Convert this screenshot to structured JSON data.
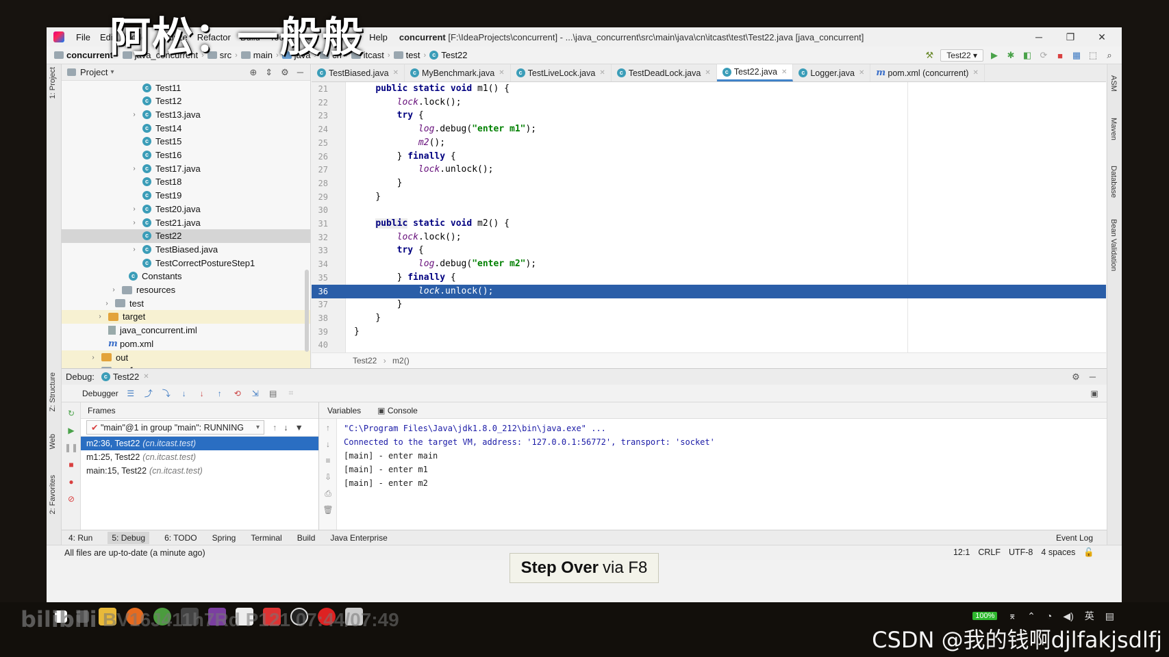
{
  "overlay": {
    "title": "阿松：一般般"
  },
  "menu": {
    "items": [
      "File",
      "Edit",
      "Code",
      "Analyze",
      "Refactor",
      "Build",
      "Tools",
      "VCS",
      "Window",
      "Help"
    ],
    "window_title_bold": "concurrent",
    "window_title_rest": "[F:\\IdeaProjects\\concurrent] - ...\\java_concurrent\\src\\main\\java\\cn\\itcast\\test\\Test22.java [java_concurrent]"
  },
  "navbar": {
    "crumbs": [
      "concurrent",
      "java_concurrent",
      "src",
      "main",
      "java",
      "cn",
      "itcast",
      "test",
      "Test22"
    ],
    "run_config": "Test22"
  },
  "project": {
    "title": "Project",
    "tree": [
      {
        "label": "Test11",
        "kind": "class",
        "indent": 2,
        "chev": false
      },
      {
        "label": "Test12",
        "kind": "class",
        "indent": 2,
        "chev": false
      },
      {
        "label": "Test13.java",
        "kind": "class",
        "indent": 2,
        "chev": true
      },
      {
        "label": "Test14",
        "kind": "class",
        "indent": 2,
        "chev": false
      },
      {
        "label": "Test15",
        "kind": "class",
        "indent": 2,
        "chev": false
      },
      {
        "label": "Test16",
        "kind": "class",
        "indent": 2,
        "chev": false
      },
      {
        "label": "Test17.java",
        "kind": "class",
        "indent": 2,
        "chev": true
      },
      {
        "label": "Test18",
        "kind": "class",
        "indent": 2,
        "chev": false
      },
      {
        "label": "Test19",
        "kind": "class",
        "indent": 2,
        "chev": false
      },
      {
        "label": "Test20.java",
        "kind": "class",
        "indent": 2,
        "chev": true
      },
      {
        "label": "Test21.java",
        "kind": "class",
        "indent": 2,
        "chev": true
      },
      {
        "label": "Test22",
        "kind": "class",
        "indent": 2,
        "chev": false,
        "selected": true
      },
      {
        "label": "TestBiased.java",
        "kind": "class",
        "indent": 2,
        "chev": true
      },
      {
        "label": "TestCorrectPostureStep1",
        "kind": "class",
        "indent": 2,
        "chev": false
      },
      {
        "label": "Constants",
        "kind": "class",
        "indent": 1,
        "chev": false
      },
      {
        "label": "resources",
        "kind": "folder",
        "indent": 0.5,
        "chev": true
      },
      {
        "label": "test",
        "kind": "folder",
        "indent": 0,
        "chev": true
      },
      {
        "label": "target",
        "kind": "folder-orange",
        "indent": -0.5,
        "chev": true,
        "yellow": true
      },
      {
        "label": "java_concurrent.iml",
        "kind": "iml",
        "indent": -0.5,
        "chev": false
      },
      {
        "label": "pom.xml",
        "kind": "maven",
        "indent": -0.5,
        "chev": false
      },
      {
        "label": "out",
        "kind": "folder-orange",
        "indent": -1,
        "chev": true,
        "yellow": true
      },
      {
        "label": "performance",
        "kind": "folder",
        "indent": -1,
        "chev": true,
        "yellow": true
      }
    ]
  },
  "editor": {
    "tabs": [
      {
        "label": "TestBiased.java",
        "active": false
      },
      {
        "label": "MyBenchmark.java",
        "active": false
      },
      {
        "label": "TestLiveLock.java",
        "active": false
      },
      {
        "label": "TestDeadLock.java",
        "active": false
      },
      {
        "label": "Test22.java",
        "active": true
      },
      {
        "label": "Logger.java",
        "active": false
      },
      {
        "label": "pom.xml (concurrent)",
        "active": false
      }
    ],
    "lines": [
      {
        "n": "21",
        "html": "    <span class=\"kw\">public static void</span> m1() {"
      },
      {
        "n": "22",
        "html": "        <span class=\"it\">lock</span>.lock();"
      },
      {
        "n": "23",
        "html": "        <span class=\"kw\">try</span> {"
      },
      {
        "n": "24",
        "html": "            <span class=\"it\">log</span>.debug(<span class=\"str\">\"enter m1\"</span>);"
      },
      {
        "n": "25",
        "html": "            <span class=\"it\">m2</span>();"
      },
      {
        "n": "26",
        "html": "        } <span class=\"kw\">finally</span> {"
      },
      {
        "n": "27",
        "html": "            <span class=\"it\">lock</span>.unlock();"
      },
      {
        "n": "28",
        "html": "        }"
      },
      {
        "n": "29",
        "html": "    }"
      },
      {
        "n": "30",
        "html": ""
      },
      {
        "n": "31",
        "html": "    <span class=\"kwhl\">public</span> <span class=\"kw\">static void</span> m2() {"
      },
      {
        "n": "32",
        "html": "        <span class=\"it\">lock</span>.lock();"
      },
      {
        "n": "33",
        "html": "        <span class=\"kw\">try</span> {"
      },
      {
        "n": "34",
        "html": "            <span class=\"it\">log</span>.debug(<span class=\"str\">\"enter m2\"</span>);"
      },
      {
        "n": "35",
        "html": "        } <span class=\"kw\">finally</span> {"
      },
      {
        "n": "36",
        "html": "            <span class=\"it\">lock</span>.unlock();",
        "highlight": true
      },
      {
        "n": "37",
        "html": "        }"
      },
      {
        "n": "38",
        "html": "    }"
      },
      {
        "n": "39",
        "html": "}"
      },
      {
        "n": "40",
        "html": ""
      }
    ],
    "breadcrumb_class": "Test22",
    "breadcrumb_method": "m2()"
  },
  "debug": {
    "label": "Debug:",
    "session": "Test22",
    "debugger_tab": "Debugger",
    "frames_title": "Frames",
    "thread": "\"main\"@1 in group \"main\": RUNNING",
    "frames": [
      {
        "loc": "m2:36, Test22",
        "pkg": "(cn.itcast.test)",
        "selected": true
      },
      {
        "loc": "m1:25, Test22",
        "pkg": "(cn.itcast.test)"
      },
      {
        "loc": "main:15, Test22",
        "pkg": "(cn.itcast.test)"
      }
    ],
    "variables_tab": "Variables",
    "console_tab": "Console",
    "console": [
      "\"C:\\Program Files\\Java\\jdk1.8.0_212\\bin\\java.exe\" ...",
      "Connected to the target VM, address: '127.0.0.1:56772', transport: 'socket'",
      "[main] - enter main",
      "[main] - enter m1",
      "[main] - enter m2"
    ]
  },
  "bottom_tabs": [
    "4: Run",
    "5: Debug",
    "6: TODO",
    "Spring",
    "Terminal",
    "Build",
    "Java Enterprise"
  ],
  "event_log": "Event Log",
  "status": {
    "message": "All files are up-to-date (a minute ago)",
    "position": "12:1",
    "line_sep": "CRLF",
    "encoding": "UTF-8",
    "indent": "4 spaces"
  },
  "tooltip": {
    "bold": "Step Over",
    "rest": "via F8"
  },
  "left_stripe": [
    "1: Project",
    "Z: Structure",
    "Web",
    "2: Favorites"
  ],
  "right_stripe": [
    "ASM",
    "Maven",
    "Database",
    "Bean Validation"
  ],
  "taskbar": {
    "bv": "BV16J411h7Rd P121 07:44/07:49",
    "csdn": "CSDN @我的钱啊djlfakjsdlfj",
    "battery": "100%",
    "ime": "英"
  }
}
